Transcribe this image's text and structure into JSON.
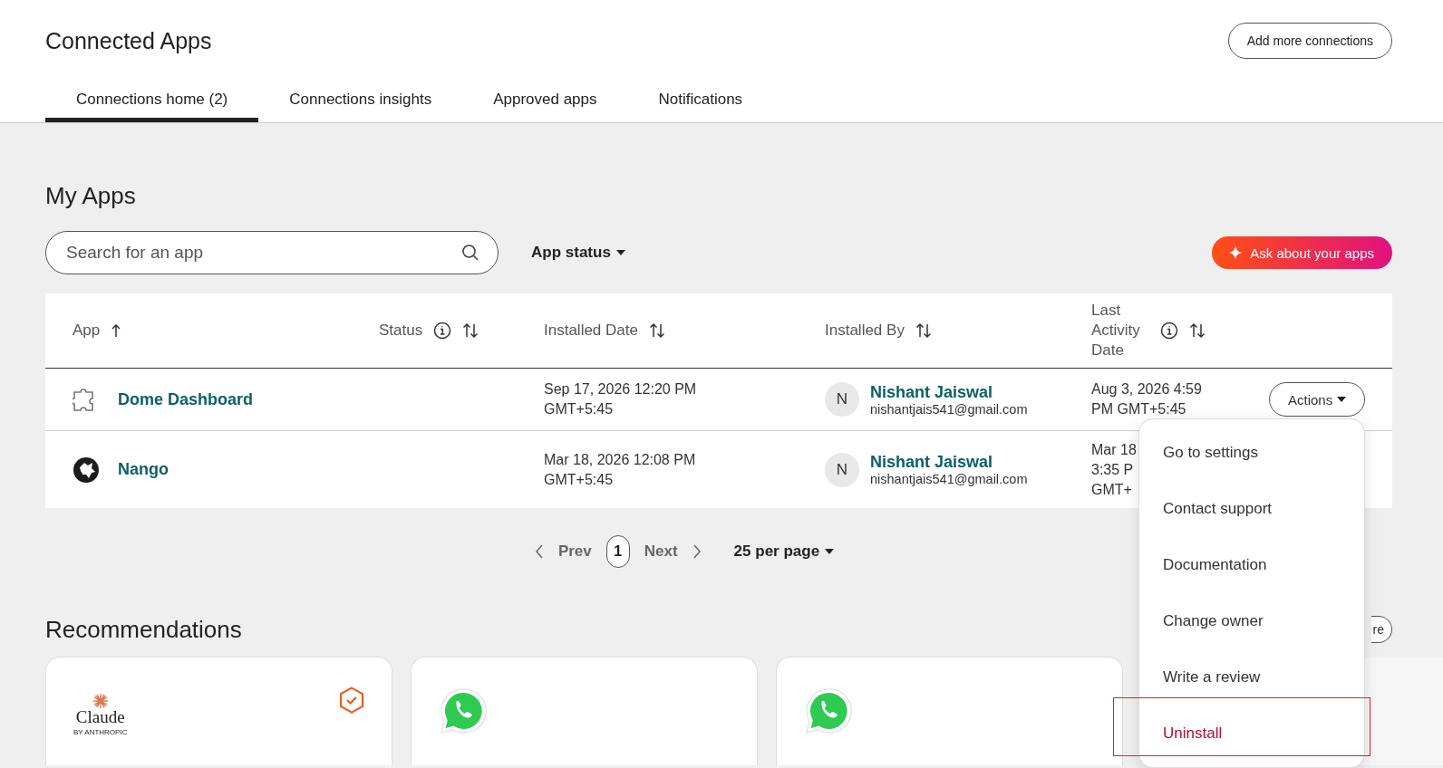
{
  "header": {
    "title": "Connected Apps",
    "add_button": "Add more connections"
  },
  "tabs": [
    {
      "label": "Connections home (2)",
      "selected": true
    },
    {
      "label": "Connections insights",
      "selected": false
    },
    {
      "label": "Approved apps",
      "selected": false
    },
    {
      "label": "Notifications",
      "selected": false
    }
  ],
  "my_apps": {
    "title": "My Apps",
    "search": {
      "placeholder": "Search for an app"
    },
    "status_filter": "App status",
    "ask_button": "Ask about your apps"
  },
  "table": {
    "columns": [
      {
        "label": "App",
        "sorted_ascending": true,
        "info": false
      },
      {
        "label": "Status",
        "sorted_ascending": false,
        "info": true
      },
      {
        "label": "Installed Date",
        "sorted_ascending": false,
        "info": false
      },
      {
        "label": "Installed By",
        "sorted_ascending": false,
        "info": false
      },
      {
        "label": "Last Activity Date",
        "sorted_ascending": false,
        "info": true
      }
    ],
    "rows": [
      {
        "kind": "puzzle",
        "app": "Dome Dashboard",
        "installed_date": [
          "Sep 17, 2026 12:20 PM",
          "GMT+5:45"
        ],
        "installer_initial": "N",
        "installer_name": "Nishant Jaiswal",
        "installer_email": "nishantjais541@gmail.com",
        "last_activity": [
          "Aug 3, 2026 4:59",
          "PM GMT+5:45"
        ],
        "actions": "Actions"
      },
      {
        "kind": "dog",
        "app": "Nango",
        "installed_date": [
          "Mar 18, 2026 12:08 PM",
          "GMT+5:45"
        ],
        "installer_initial": "N",
        "installer_name": "Nishant Jaiswal",
        "installer_email": "nishantjais541@gmail.com",
        "last_activity": [
          "Mar 18",
          "3:35 P",
          "GMT+"
        ]
      }
    ]
  },
  "actions_menu": {
    "items": [
      {
        "label": "Go to settings",
        "kind": "normal",
        "highlighted": false
      },
      {
        "label": "Contact support",
        "kind": "normal",
        "highlighted": false
      },
      {
        "label": "Documentation",
        "kind": "normal",
        "highlighted": false
      },
      {
        "label": "Change owner",
        "kind": "normal",
        "highlighted": false
      },
      {
        "label": "Write a review",
        "kind": "normal",
        "highlighted": false
      },
      {
        "label": "Uninstall",
        "kind": "danger",
        "highlighted": true
      }
    ]
  },
  "pagination": {
    "prev": "Prev",
    "page": "1",
    "next": "Next",
    "per_page": "25 per page"
  },
  "recommendations": {
    "title": "Recommendations",
    "more_button": "re",
    "cards": [
      {
        "kind": "claude",
        "logo": "Claude",
        "logo_sub": "BY ANTHROPIC",
        "verified": true
      },
      {
        "kind": "whatsapp",
        "verified": false
      },
      {
        "kind": "whatsapp",
        "verified": false
      },
      {
        "kind": "blank",
        "verified": false
      }
    ]
  }
}
